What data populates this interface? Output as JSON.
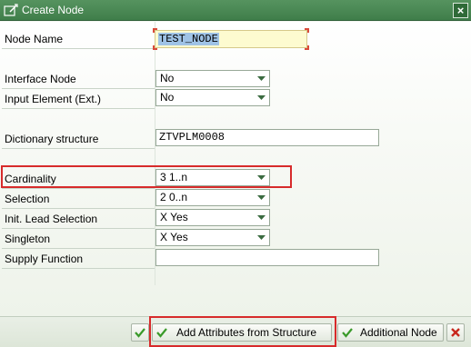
{
  "window": {
    "title": "Create Node",
    "close_label": "×"
  },
  "fields": {
    "node_name": {
      "label": "Node Name",
      "value": "TEST_NODE"
    },
    "interface_node": {
      "label": "Interface Node",
      "value": "No"
    },
    "input_element": {
      "label": "Input Element (Ext.)",
      "value": "No"
    },
    "dictionary_structure": {
      "label": "Dictionary structure",
      "value": "ZTVPLM0008"
    },
    "cardinality": {
      "label": "Cardinality",
      "value": "3 1..n"
    },
    "selection": {
      "label": "Selection",
      "value": "2 0..n"
    },
    "init_lead_selection": {
      "label": "Init. Lead Selection",
      "value": "X Yes"
    },
    "singleton": {
      "label": "Singleton",
      "value": "X Yes"
    },
    "supply_function": {
      "label": "Supply Function",
      "value": ""
    }
  },
  "buttons": {
    "add_attributes": "Add Attributes from Structure",
    "additional_node": "Additional Node"
  },
  "colors": {
    "titlebar": "#4a8a55",
    "highlight": "#d72b2b",
    "confirm_check": "#3a9a2a",
    "cancel_x": "#c8281e",
    "input_highlight": "#fdfbd0"
  }
}
